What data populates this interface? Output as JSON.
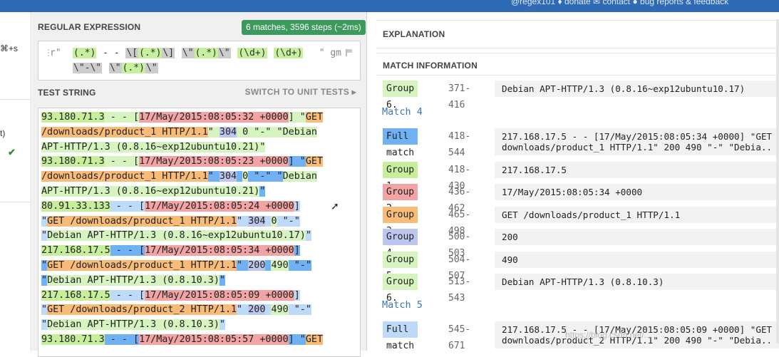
{
  "topbar": {
    "links": "@regex101   ♦ donate   ✉ contact   ● bug reports & feedback"
  },
  "leftstrip": {
    "shortcut": "⌘+s",
    "paren": "t)",
    "check": "✔"
  },
  "regex": {
    "title": "REGULAR EXPRESSION",
    "badge": "6 matches, 3596 steps (~2ms)",
    "delimiter": "r\"",
    "flags": "\" gm",
    "line1": [
      "(.*)",
      " - - ",
      "\\[",
      "(.*)",
      "\\]",
      " ",
      "\\\"",
      "(.*)",
      "\\\"",
      " ",
      "(\\d+)",
      " ",
      "(\\d+)"
    ],
    "line2": [
      "\\\"-\\\"",
      " ",
      "\\\"",
      "(.*)",
      "\\\""
    ]
  },
  "test": {
    "title": "TEST STRING",
    "switch": "SWITCH TO UNIT TESTS ▸",
    "lines": [
      [
        [
          "c-g",
          "93.180.71.3"
        ],
        [
          "c-lg",
          " - - ["
        ],
        [
          "c-r",
          "17/May/2015:08:05:32 +0000"
        ],
        [
          "c-lg",
          "] \""
        ],
        [
          "c-o",
          "GET"
        ]
      ],
      [
        [
          "c-o",
          "/downloads/product_1 HTTP/1.1"
        ],
        [
          "c-lg",
          "\" "
        ],
        [
          "c-p",
          "304"
        ],
        [
          "c-lg",
          " "
        ],
        [
          "c-lg",
          "0"
        ],
        [
          "c-lg",
          " \"-\" \""
        ],
        [
          "c-lg",
          "Debian"
        ]
      ],
      [
        [
          "c-lg",
          "APT-HTTP/1.3 (0.8.16~exp12ubuntu10.21)"
        ],
        [
          "c-lg",
          "\""
        ]
      ],
      [
        [
          "c-g",
          "93.180.71.3"
        ],
        [
          "c-lg",
          " - - ["
        ],
        [
          "c-r",
          "17/May/2015:08:05:23 +0000"
        ],
        [
          "c-mb",
          "] \""
        ],
        [
          "c-o",
          "GET"
        ]
      ],
      [
        [
          "c-o",
          "/downloads/product_1 HTTP/1.1"
        ],
        [
          "c-mb",
          "\" "
        ],
        [
          "c-p",
          "304"
        ],
        [
          "c-mb",
          " "
        ],
        [
          "c-lg",
          "0"
        ],
        [
          "c-mb",
          " \"-\" \""
        ],
        [
          "c-lg",
          "Debian"
        ]
      ],
      [
        [
          "c-lg",
          "APT-HTTP/1.3 (0.8.16~exp12ubuntu10.21)"
        ],
        [
          "c-mb",
          "\""
        ]
      ],
      [
        [
          "c-g",
          "80.91.33.133"
        ],
        [
          "c-m",
          " - - ["
        ],
        [
          "c-r",
          "17/May/2015:08:05:24 +0000"
        ],
        [
          "c-m",
          "]"
        ]
      ],
      [
        [
          "c-m",
          "\""
        ],
        [
          "c-o",
          "GET /downloads/product_1 HTTP/1.1"
        ],
        [
          "c-m",
          "\" "
        ],
        [
          "c-p",
          "304"
        ],
        [
          "c-m",
          " "
        ],
        [
          "c-lg",
          "0"
        ],
        [
          "c-m",
          " \"-\""
        ]
      ],
      [
        [
          "c-m",
          "\""
        ],
        [
          "c-lg",
          "Debian APT-HTTP/1.3 (0.8.16~exp12ubuntu10.17)"
        ],
        [
          "c-m",
          "\""
        ]
      ],
      [
        [
          "c-g",
          "217.168.17.5"
        ],
        [
          "c-mb",
          " - - ["
        ],
        [
          "c-r",
          "17/May/2015:08:05:34 +0000"
        ],
        [
          "c-mb",
          "]"
        ]
      ],
      [
        [
          "c-mb",
          "\""
        ],
        [
          "c-o",
          "GET /downloads/product_1 HTTP/1.1"
        ],
        [
          "c-mb",
          "\" "
        ],
        [
          "c-p",
          "200"
        ],
        [
          "c-mb",
          " "
        ],
        [
          "c-lg",
          "490"
        ],
        [
          "c-mb",
          " \"-\""
        ]
      ],
      [
        [
          "c-mb",
          "\""
        ],
        [
          "c-lg",
          "Debian APT-HTTP/1.3 (0.8.10.3)"
        ],
        [
          "c-mb",
          "\""
        ]
      ],
      [
        [
          "c-g",
          "217.168.17.5"
        ],
        [
          "c-m",
          " - - ["
        ],
        [
          "c-r",
          "17/May/2015:08:05:09 +0000"
        ],
        [
          "c-m",
          "]"
        ]
      ],
      [
        [
          "c-m",
          "\""
        ],
        [
          "c-o",
          "GET /downloads/product_2 HTTP/1.1"
        ],
        [
          "c-m",
          "\" "
        ],
        [
          "c-p",
          "200"
        ],
        [
          "c-m",
          " "
        ],
        [
          "c-lg",
          "490"
        ],
        [
          "c-m",
          " \"-\""
        ]
      ],
      [
        [
          "c-m",
          "\""
        ],
        [
          "c-lg",
          "Debian APT-HTTP/1.3 (0.8.10.3)"
        ],
        [
          "c-m",
          "\""
        ]
      ],
      [
        [
          "c-g",
          "93.180.71.3"
        ],
        [
          "c-mb",
          " - - ["
        ],
        [
          "c-r",
          "17/May/2015:08:05:57 +0000"
        ],
        [
          "c-mb",
          "] \""
        ],
        [
          "c-o",
          "GET"
        ]
      ]
    ]
  },
  "explanation": {
    "title": "EXPLANATION"
  },
  "matchinfo": {
    "title": "MATCH INFORMATION",
    "rows": [
      {
        "kind": "group",
        "label": "Group 6.",
        "color": "#d6f4c0",
        "range": "371-416",
        "value": "Debian APT-HTTP/1.3 (0.8.16~exp12ubuntu10.17)"
      },
      {
        "kind": "title",
        "label": "Match 4"
      },
      {
        "kind": "full",
        "label": "Full match",
        "color": "#6fb1f2",
        "range": "418-544",
        "value": "217.168.17.5 - - [17/May/2015:08:05:34 +0000] \"GET\ndownloads/product_1 HTTP/1.1\" 200 490 \"-\" \"Debia.."
      },
      {
        "kind": "group",
        "label": "Group 1.",
        "color": "#c7ee9a",
        "range": "418-430",
        "value": "217.168.17.5"
      },
      {
        "kind": "group",
        "label": "Group 2.",
        "color": "#f2a3a3",
        "range": "436-462",
        "value": "17/May/2015:08:05:34 +0000"
      },
      {
        "kind": "group",
        "label": "Group 3.",
        "color": "#f8bb78",
        "range": "465-498",
        "value": "GET /downloads/product_1 HTTP/1.1"
      },
      {
        "kind": "group",
        "label": "Group 4.",
        "color": "#bcc6ee",
        "range": "500-503",
        "value": "200"
      },
      {
        "kind": "group",
        "label": "Group 5.",
        "color": "#d6f4c0",
        "range": "504-507",
        "value": "490"
      },
      {
        "kind": "group",
        "label": "Group 6.",
        "color": "#d6f4c0",
        "range": "513-543",
        "value": "Debian APT-HTTP/1.3 (0.8.10.3)"
      },
      {
        "kind": "title",
        "label": "Match 5"
      },
      {
        "kind": "full",
        "label": "Full match",
        "color": "#bedafb",
        "range": "545-671",
        "value": "217.168.17.5 - - [17/May/2015:08:05:09 +0000] \"GET\ndownloads/product_2 HTTP/1.1\" 200 490 \"-\" \"Debia.."
      }
    ]
  },
  "watermark": "https://blog.csdn.net/..."
}
